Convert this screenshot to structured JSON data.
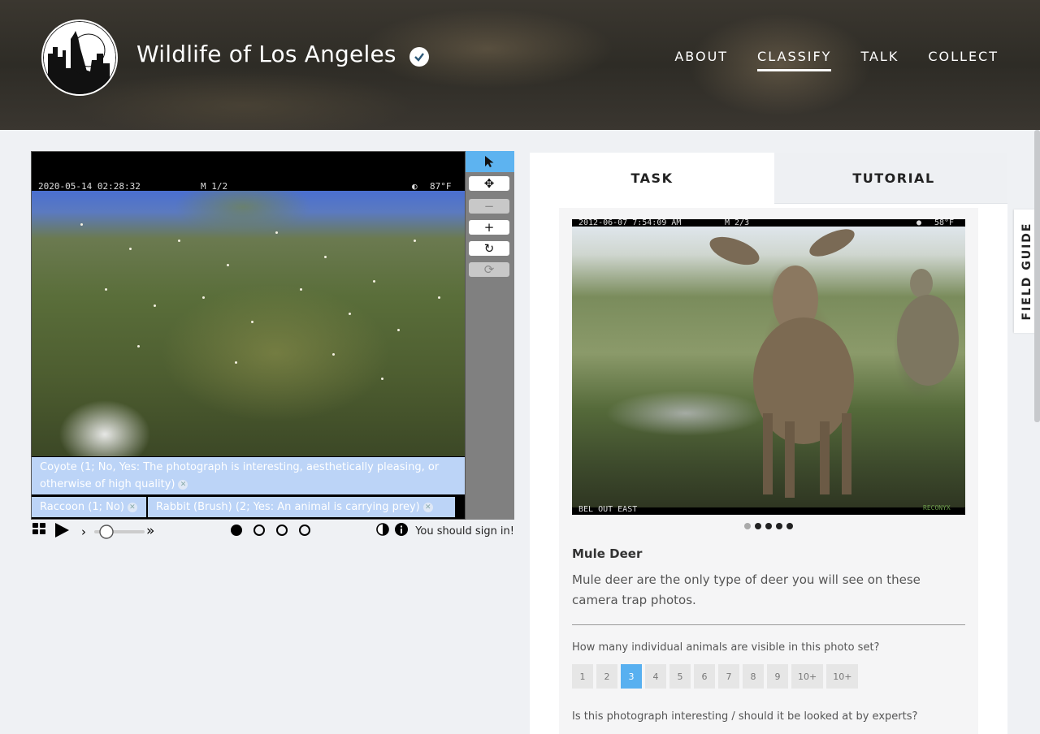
{
  "header": {
    "project_title": "Wildlife of Los Angeles",
    "nav": [
      {
        "label": "ABOUT",
        "active": false
      },
      {
        "label": "CLASSIFY",
        "active": true
      },
      {
        "label": "TALK",
        "active": false
      },
      {
        "label": "COLLECT",
        "active": false
      }
    ]
  },
  "viewer": {
    "timestamp": "2020-05-14 02:28:32",
    "frame_code": "M 1/2",
    "temperature": "87°F",
    "annotations": [
      "Coyote (1; No, Yes: The photograph is interesting, aesthetically pleasing, or otherwise of high quality)",
      "Raccoon (1; No)",
      "Rabbit (Brush) (2; Yes: An animal is carrying prey)"
    ],
    "frames": {
      "count": 4,
      "current": 1
    },
    "signin_text": "You should sign in!"
  },
  "toolbar": {
    "tools": [
      {
        "name": "pointer-icon",
        "glyph": "➤",
        "state": "selected"
      },
      {
        "name": "move-icon",
        "glyph": "✥",
        "state": "enabled"
      },
      {
        "name": "zoom-out-icon",
        "glyph": "−",
        "state": "disabled"
      },
      {
        "name": "zoom-in-icon",
        "glyph": "+",
        "state": "enabled"
      },
      {
        "name": "rotate-icon",
        "glyph": "↻",
        "state": "enabled"
      },
      {
        "name": "reset-icon",
        "glyph": "⟳",
        "state": "disabled"
      }
    ]
  },
  "panel": {
    "tabs": [
      "TASK",
      "TUTORIAL"
    ],
    "field_guide_label": "FIELD GUIDE",
    "example": {
      "timestamp": "2012-06-07 7:54:09 AM",
      "frame_code": "M 2/3",
      "temperature": "58°F",
      "location": "BEL OUT EAST",
      "brand": "RECONYX",
      "image_count": 5,
      "image_current": 1
    },
    "species_name": "Mule Deer",
    "species_description": "Mule deer are the only type of deer you will see on these camera trap photos.",
    "question_1": "How many individual animals are visible in this photo set?",
    "count_options": [
      "1",
      "2",
      "3",
      "4",
      "5",
      "6",
      "7",
      "8",
      "9",
      "10+",
      "10+"
    ],
    "count_selected": "3",
    "question_2": "Is this photograph interesting / should it be looked at by experts?"
  },
  "colors": {
    "accent": "#58b0f0",
    "annotation": "#bcd4f7"
  }
}
